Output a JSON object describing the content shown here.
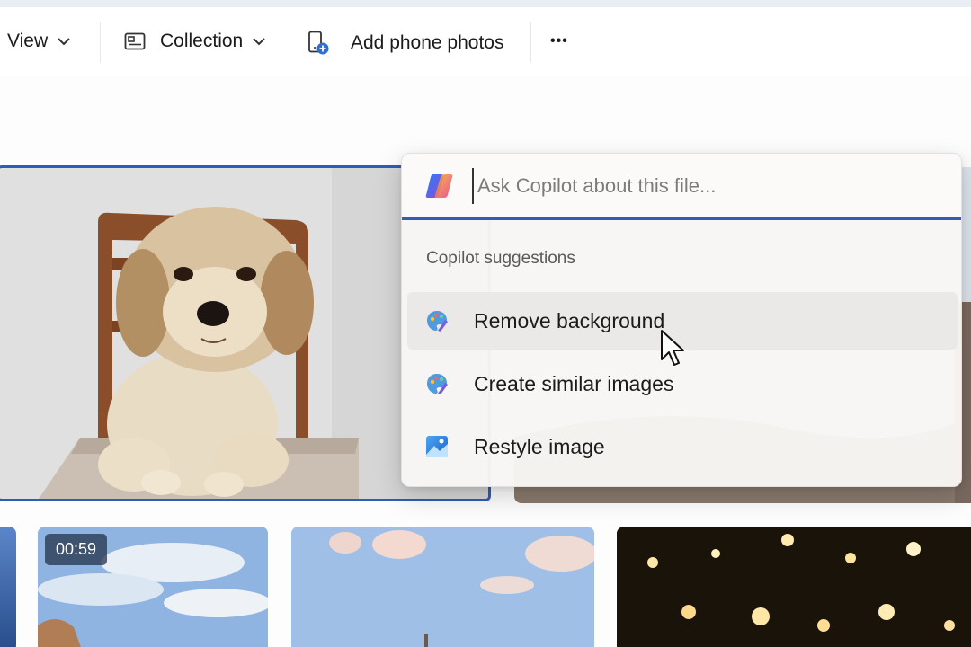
{
  "toolbar": {
    "view_label": "View",
    "collection_label": "Collection",
    "add_phone_photos_label": "Add phone photos",
    "more_label": "•••"
  },
  "copilot": {
    "input_placeholder": "Ask Copilot about this file...",
    "suggestions_heading": "Copilot suggestions",
    "suggestions": [
      {
        "label": "Remove background",
        "icon": "paint-palette-icon"
      },
      {
        "label": "Create similar images",
        "icon": "paint-palette-icon"
      },
      {
        "label": "Restyle image",
        "icon": "image-landscape-icon"
      }
    ],
    "accent_color": "#2f5fb4"
  },
  "gallery": {
    "video_duration": "00:59"
  },
  "colors": {
    "selection_border": "#2b5fb3",
    "hover_background": "#ebe9e7"
  }
}
